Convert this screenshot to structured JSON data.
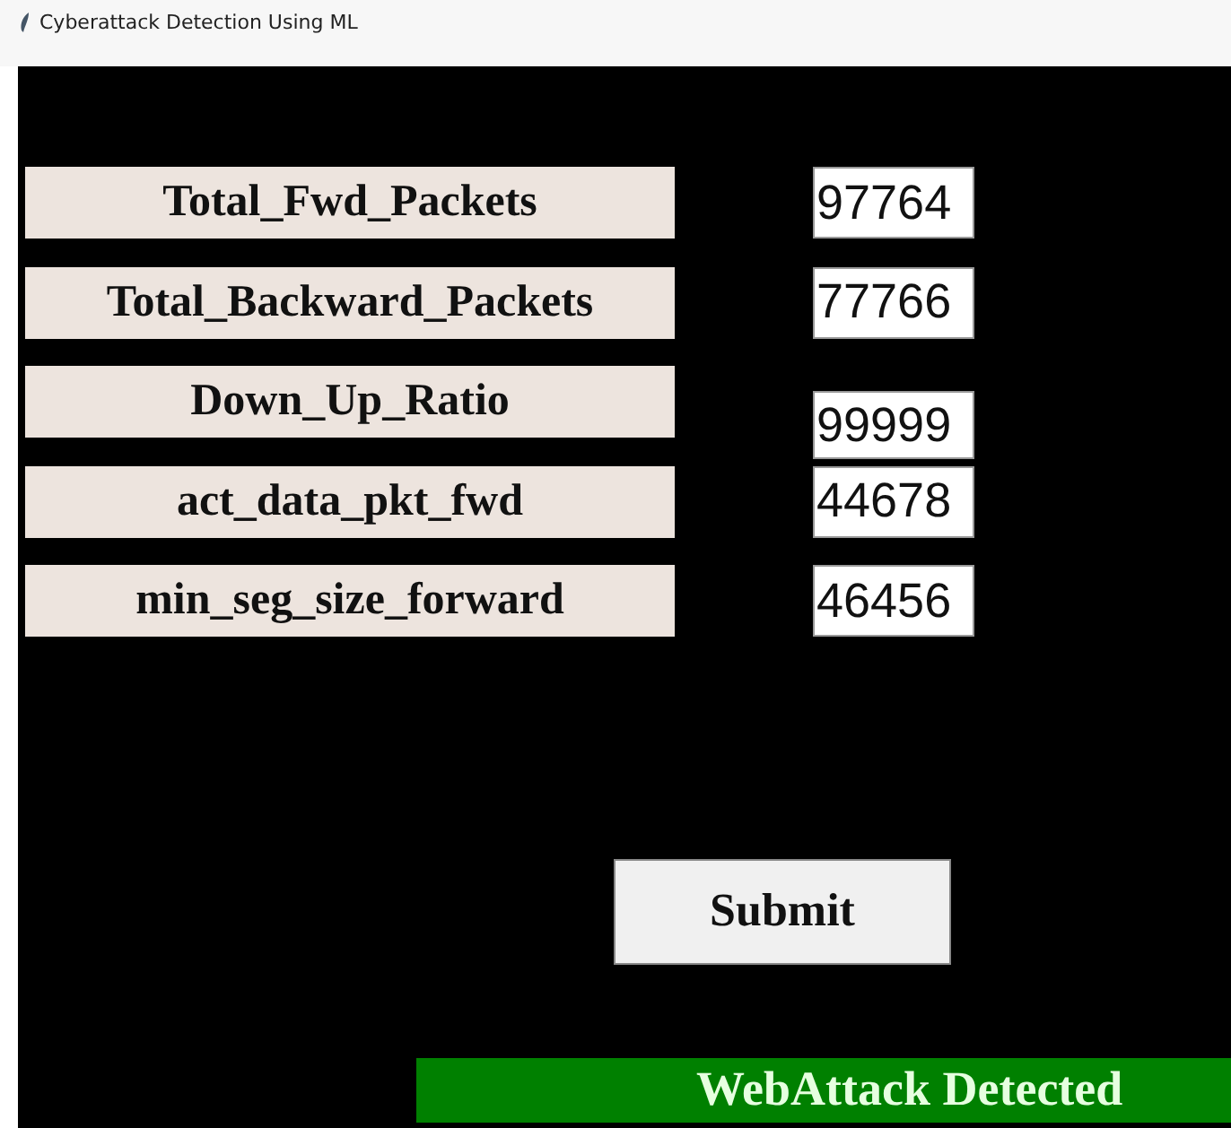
{
  "window": {
    "title": "Cyberattack Detection Using ML"
  },
  "fields": [
    {
      "label": "Total_Fwd_Packets",
      "value": "97764"
    },
    {
      "label": "Total_Backward_Packets",
      "value": "77766"
    },
    {
      "label": "Down_Up_Ratio",
      "value": "99999"
    },
    {
      "label": "act_data_pkt_fwd",
      "value": "44678"
    },
    {
      "label": "min_seg_size_forward",
      "value": "46456"
    }
  ],
  "submit_button": "Submit",
  "result": "WebAttack Detected"
}
